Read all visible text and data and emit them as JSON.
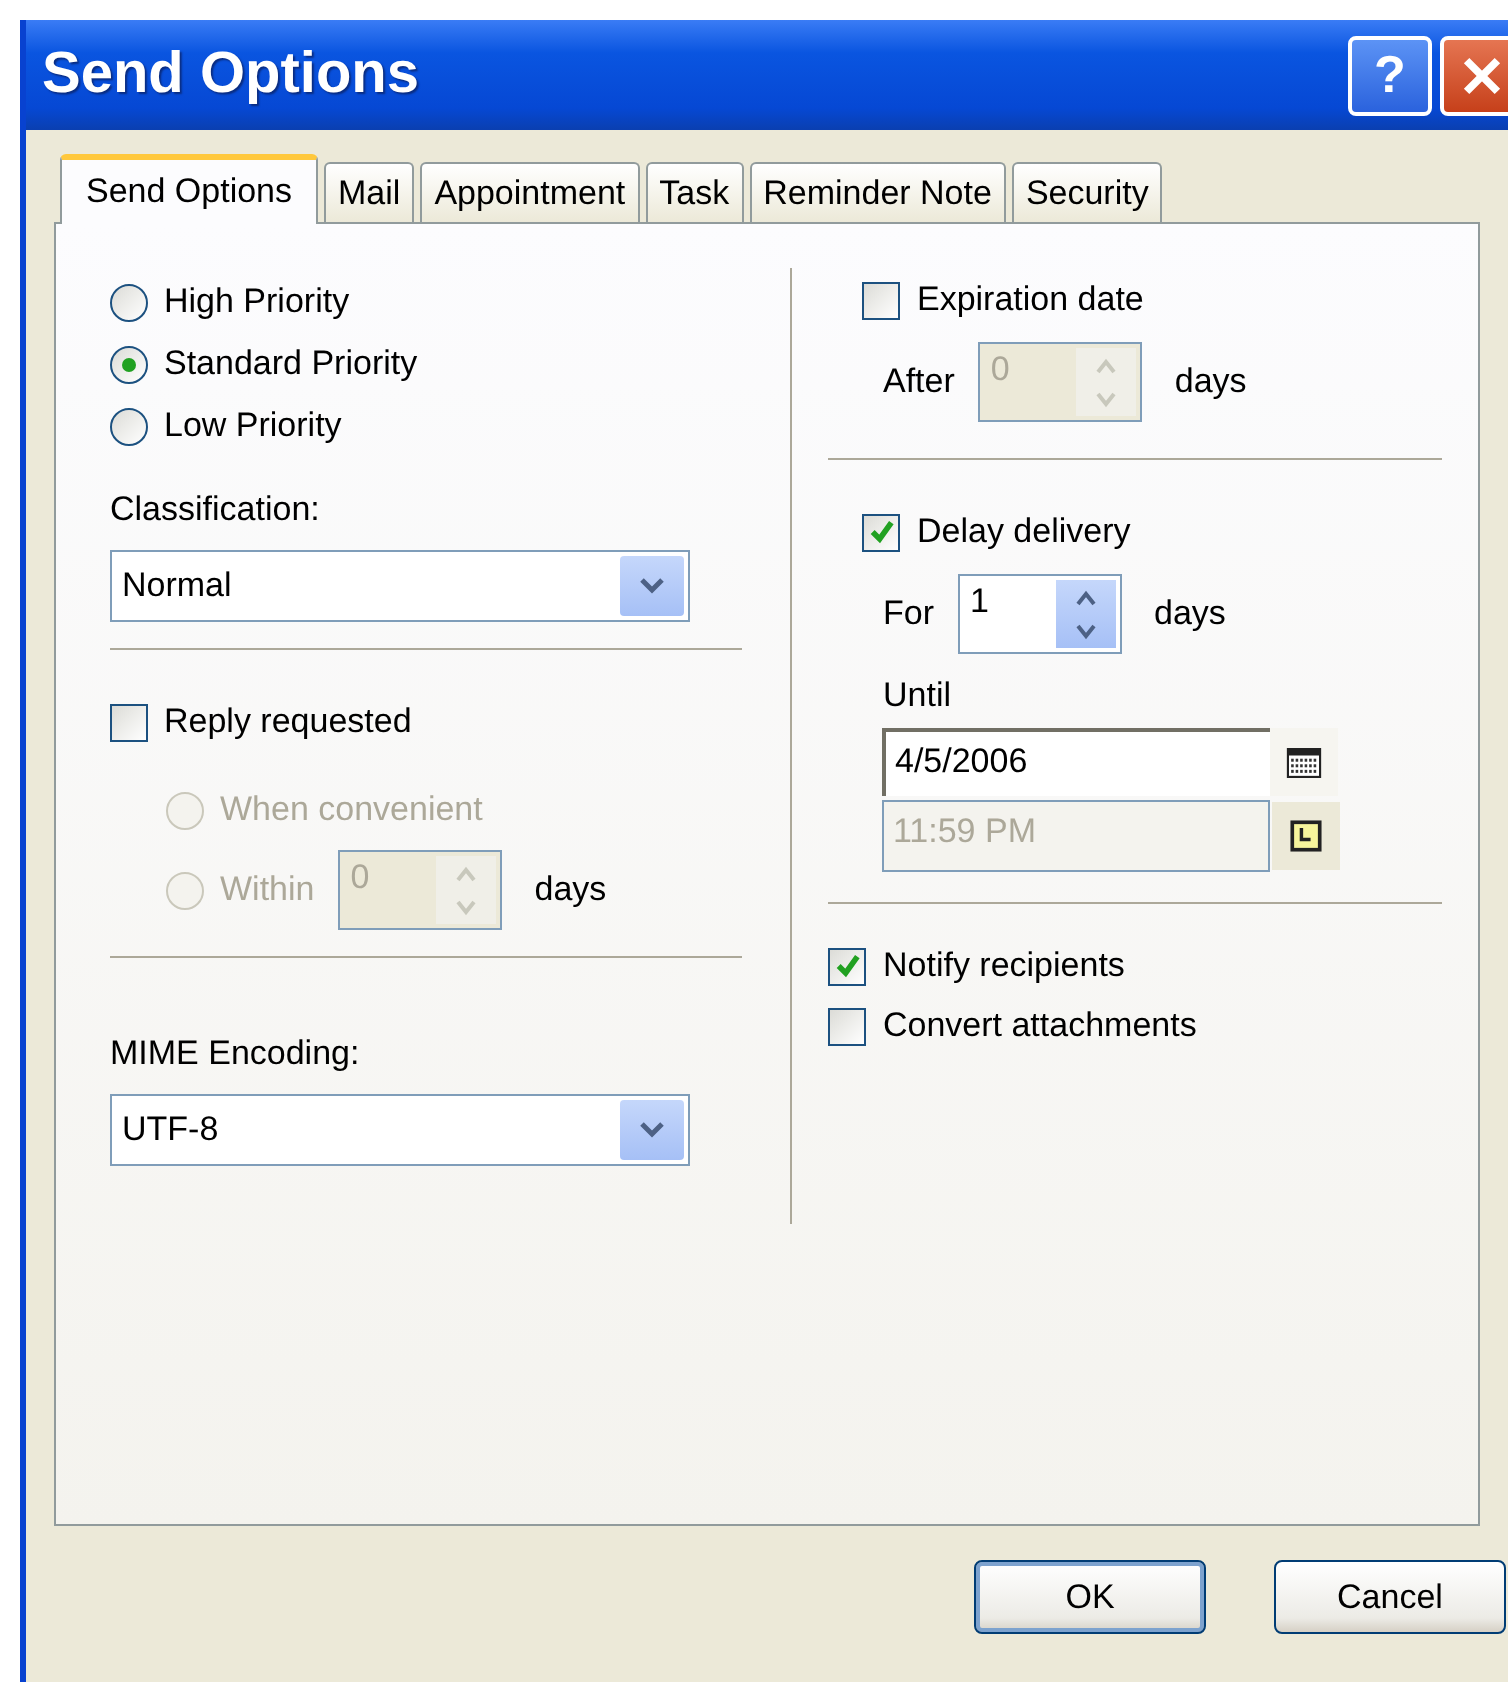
{
  "window": {
    "title": "Send Options",
    "help": "?"
  },
  "tabs": [
    {
      "label": "Send Options",
      "selected": true
    },
    {
      "label": "Mail",
      "selected": false
    },
    {
      "label": "Appointment",
      "selected": false
    },
    {
      "label": "Task",
      "selected": false
    },
    {
      "label": "Reminder Note",
      "selected": false
    },
    {
      "label": "Security",
      "selected": false
    }
  ],
  "priority": [
    {
      "label": "High Priority",
      "selected": false
    },
    {
      "label": "Standard Priority",
      "selected": true
    },
    {
      "label": "Low Priority",
      "selected": false
    }
  ],
  "classification": {
    "label": "Classification:",
    "value": "Normal"
  },
  "reply_requested": {
    "label": "Reply requested",
    "checked": false,
    "options": [
      {
        "kind": "plain",
        "label": "When convenient",
        "selected": false,
        "disabled": true
      },
      {
        "kind": "spin",
        "label": "Within",
        "selected": false,
        "disabled": true,
        "value": "0",
        "unit": "days"
      }
    ]
  },
  "mime_encoding": {
    "label": "MIME Encoding:",
    "value": "UTF-8"
  },
  "expiration": {
    "label": "Expiration date",
    "checked": false,
    "after": {
      "label": "After",
      "value": "0",
      "unit": "days",
      "disabled": true
    }
  },
  "delay_delivery": {
    "label": "Delay delivery",
    "checked": true,
    "for": {
      "label": "For",
      "value": "1",
      "unit": "days",
      "disabled": false
    },
    "until": {
      "label": "Until",
      "date": "4/5/2006",
      "time": "11:59 PM",
      "time_disabled": true
    }
  },
  "options": [
    {
      "label": "Notify recipients",
      "checked": true
    },
    {
      "label": "Convert attachments",
      "checked": false
    }
  ],
  "buttons": [
    {
      "label": "OK",
      "default": true
    },
    {
      "label": "Cancel",
      "default": false
    }
  ]
}
